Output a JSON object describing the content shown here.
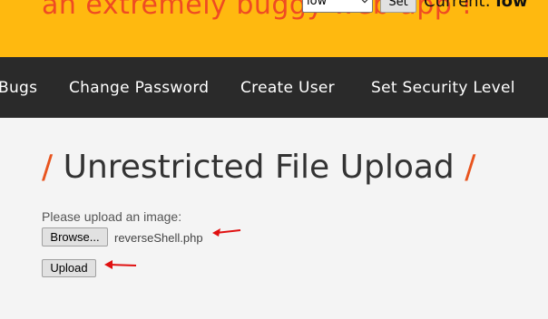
{
  "header": {
    "tagline": "an extremely buggy web app !",
    "security_select_value": "low",
    "set_label": "Set",
    "current_prefix": "Current:",
    "current_value": "low"
  },
  "nav": {
    "items": [
      "Bugs",
      "Change Password",
      "Create User",
      "Set Security Level"
    ]
  },
  "main": {
    "title_slash_left": "/",
    "title": "Unrestricted File Upload",
    "title_slash_right": "/",
    "upload_label": "Please upload an image:",
    "browse_label": "Browse...",
    "file_name": "reverseShell.php",
    "upload_label_button": "Upload"
  },
  "colors": {
    "header_bg": "#ffb90f",
    "tagline": "#ef4b23",
    "nav_bg": "#2a2a2a",
    "accent_slash": "#e8541e",
    "annotation_arrow": "#e01010"
  }
}
